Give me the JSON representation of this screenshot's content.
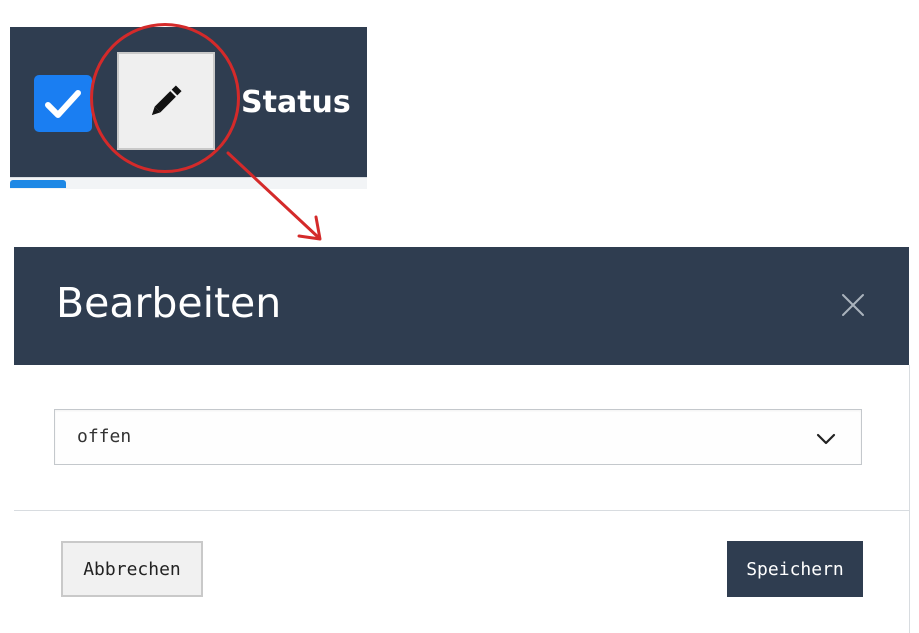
{
  "header_snippet": {
    "column_label": "Status",
    "checkbox_checked": true,
    "icons": {
      "checkbox": "checkmark-icon",
      "edit": "pencil-icon"
    }
  },
  "annotation": {
    "color": "#d42a2a"
  },
  "modal": {
    "title": "Bearbeiten",
    "close_icon": "close-icon",
    "status_select": {
      "value": "offen",
      "icon": "chevron-down-icon"
    },
    "cancel_label": "Abbrechen",
    "save_label": "Speichern"
  },
  "colors": {
    "header_bg": "#2f3d50",
    "checkbox_blue": "#1a7ef2",
    "annotation_red": "#d42a2a"
  }
}
